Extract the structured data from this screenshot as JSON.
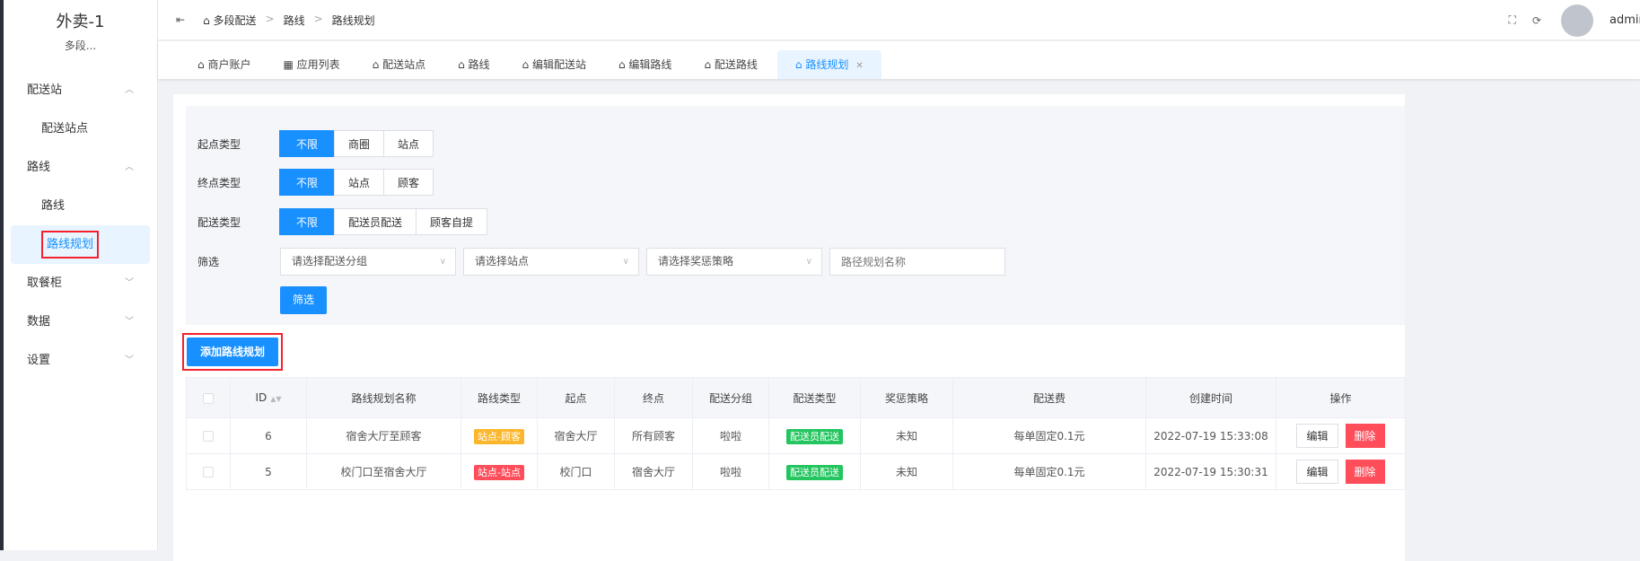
{
  "sidebar": {
    "title": "外卖-1",
    "subtitle": "多段...",
    "items": [
      {
        "label": "配送站",
        "type": "group",
        "open": true
      },
      {
        "label": "配送站点",
        "type": "sub"
      },
      {
        "label": "路线",
        "type": "group",
        "open": true
      },
      {
        "label": "路线",
        "type": "sub"
      },
      {
        "label": "路线规划",
        "type": "sub",
        "active": true
      },
      {
        "label": "取餐柜",
        "type": "group",
        "open": false
      },
      {
        "label": "数据",
        "type": "group",
        "open": false
      },
      {
        "label": "设置",
        "type": "group",
        "open": false
      }
    ]
  },
  "header": {
    "breadcrumb": [
      "多段配送",
      "路线",
      "路线规划"
    ],
    "user": "admin"
  },
  "tabs": [
    {
      "label": "商户账户",
      "icon": "shop-icon"
    },
    {
      "label": "应用列表",
      "icon": "apps-icon"
    },
    {
      "label": "配送站点",
      "icon": "home-icon"
    },
    {
      "label": "路线",
      "icon": "home-icon"
    },
    {
      "label": "编辑配送站",
      "icon": "home-icon"
    },
    {
      "label": "编辑路线",
      "icon": "home-icon"
    },
    {
      "label": "配送路线",
      "icon": "home-icon"
    },
    {
      "label": "路线规划",
      "icon": "home-icon",
      "active": true
    }
  ],
  "filter": {
    "start_label": "起点类型",
    "start_opts": [
      "不限",
      "商圈",
      "站点"
    ],
    "end_label": "终点类型",
    "end_opts": [
      "不限",
      "站点",
      "顾客"
    ],
    "delivery_label": "配送类型",
    "delivery_opts": [
      "不限",
      "配送员配送",
      "顾客自提"
    ],
    "screen_label": "筛选",
    "group_placeholder": "请选择配送分组",
    "station_placeholder": "请选择站点",
    "reward_placeholder": "请选择奖惩策略",
    "name_placeholder": "路径规划名称",
    "submit": "筛选"
  },
  "add_button": "添加路线规划",
  "table": {
    "headers": [
      "ID",
      "路线规划名称",
      "路线类型",
      "起点",
      "终点",
      "配送分组",
      "配送类型",
      "奖惩策略",
      "配送费",
      "创建时间",
      "操作"
    ],
    "rows": [
      {
        "id": "6",
        "name": "宿舍大厅至顾客",
        "type": "站点-顾客",
        "type_color": "#fbb62b",
        "start": "宿舍大厅",
        "end": "所有顾客",
        "group": "啦啦",
        "dtype": "配送员配送",
        "reward": "未知",
        "fee": "每单固定0.1元",
        "time": "2022-07-19 15:33:08"
      },
      {
        "id": "5",
        "name": "校门口至宿舍大厅",
        "type": "站点-站点",
        "type_color": "#ff4d5a",
        "start": "校门口",
        "end": "宿舍大厅",
        "group": "啦啦",
        "dtype": "配送员配送",
        "reward": "未知",
        "fee": "每单固定0.1元",
        "time": "2022-07-19 15:30:31"
      }
    ],
    "edit": "编辑",
    "delete": "删除"
  },
  "colors": {
    "primary": "#1890ff",
    "danger": "#ff4d5a",
    "success": "#22c55e"
  }
}
